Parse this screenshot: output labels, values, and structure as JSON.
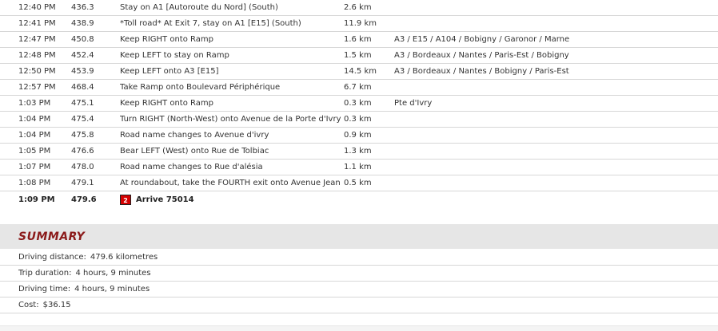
{
  "steps": [
    {
      "time": "12:40 PM",
      "distance": "436.3",
      "instruction": "Stay on A1 [Autoroute du Nord] (South)",
      "leg": "2.6 km",
      "road": ""
    },
    {
      "time": "12:41 PM",
      "distance": "438.9",
      "instruction": "*Toll road* At Exit 7, stay on A1 [E15] (South)",
      "leg": "11.9 km",
      "road": ""
    },
    {
      "time": "12:47 PM",
      "distance": "450.8",
      "instruction": "Keep RIGHT onto Ramp",
      "leg": "1.6 km",
      "road": "A3 / E15 / A104 / Bobigny / Garonor / Marne"
    },
    {
      "time": "12:48 PM",
      "distance": "452.4",
      "instruction": "Keep LEFT to stay on Ramp",
      "leg": "1.5 km",
      "road": "A3 / Bordeaux / Nantes / Paris-Est / Bobigny"
    },
    {
      "time": "12:50 PM",
      "distance": "453.9",
      "instruction": "Keep LEFT onto A3 [E15]",
      "leg": "14.5 km",
      "road": "A3 / Bordeaux / Nantes / Bobigny / Paris-Est"
    },
    {
      "time": "12:57 PM",
      "distance": "468.4",
      "instruction": "Take Ramp onto Boulevard Périphérique",
      "leg": "6.7 km",
      "road": ""
    },
    {
      "time": "1:03 PM",
      "distance": "475.1",
      "instruction": "Keep RIGHT onto Ramp",
      "leg": "0.3 km",
      "road": "Pte d'Ivry"
    },
    {
      "time": "1:04 PM",
      "distance": "475.4",
      "instruction": "Turn RIGHT (North-West) onto Avenue de la Porte d'Ivry",
      "leg": "0.3 km",
      "road": ""
    },
    {
      "time": "1:04 PM",
      "distance": "475.8",
      "instruction": "Road name changes to Avenue d'ivry",
      "leg": "0.9 km",
      "road": ""
    },
    {
      "time": "1:05 PM",
      "distance": "476.6",
      "instruction": "Bear LEFT (West) onto Rue de Tolbiac",
      "leg": "1.3 km",
      "road": ""
    },
    {
      "time": "1:07 PM",
      "distance": "478.0",
      "instruction": "Road name changes to Rue d'alésia",
      "leg": "1.1 km",
      "road": ""
    },
    {
      "time": "1:08 PM",
      "distance": "479.1",
      "instruction": "At roundabout, take the FOURTH exit onto Avenue Jean",
      "leg": "0.5 km",
      "road": ""
    }
  ],
  "arrival": {
    "time": "1:09 PM",
    "distance": "479.6",
    "flag_number": "2",
    "label": "Arrive 75014",
    "flag_color": "#d40000"
  },
  "summary": {
    "title": "SUMMARY",
    "title_color": "#8b1a1a",
    "items": [
      {
        "label": "Driving distance:",
        "value": "479.6 kilometres"
      },
      {
        "label": "Trip duration:",
        "value": "4 hours, 9 minutes"
      },
      {
        "label": "Driving time:",
        "value": "4 hours, 9 minutes"
      },
      {
        "label": "Cost:",
        "value": "$36.15"
      }
    ]
  }
}
